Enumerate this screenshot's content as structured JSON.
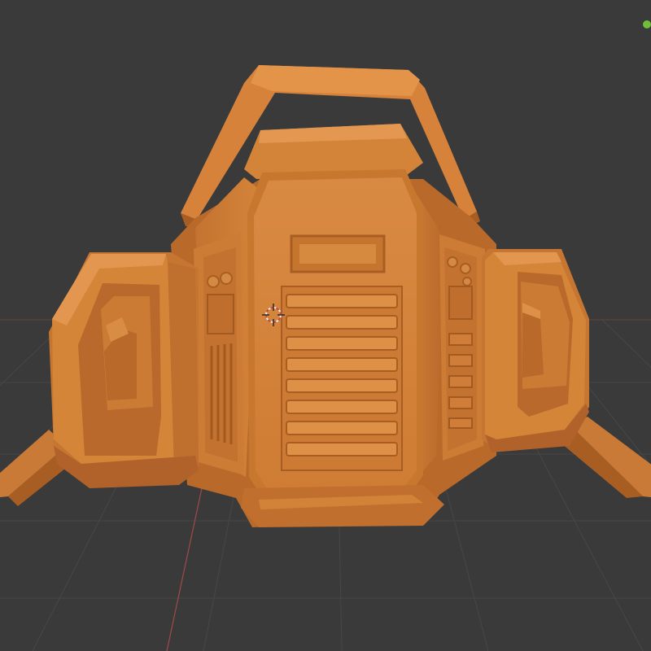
{
  "viewport": {
    "kind": "blender-3d-viewport",
    "shading_mode": "solid",
    "background_color": "#3a3a3a",
    "grid_color": "#484848",
    "x_axis_color": "#a04a4a",
    "y_axis_color": "#6a8a3a"
  },
  "model": {
    "name": "orange-sci-fi-backpack",
    "material_color": "#d6823a",
    "shadow_color": "#a85e22",
    "highlight_color": "#e79a52"
  },
  "gizmo": {
    "indicator_color": "#6fbf3a"
  },
  "cursor_3d": {
    "icon": "crosshair-3d-cursor-icon",
    "colors": [
      "#c84a3a",
      "#f0f0f0"
    ]
  }
}
